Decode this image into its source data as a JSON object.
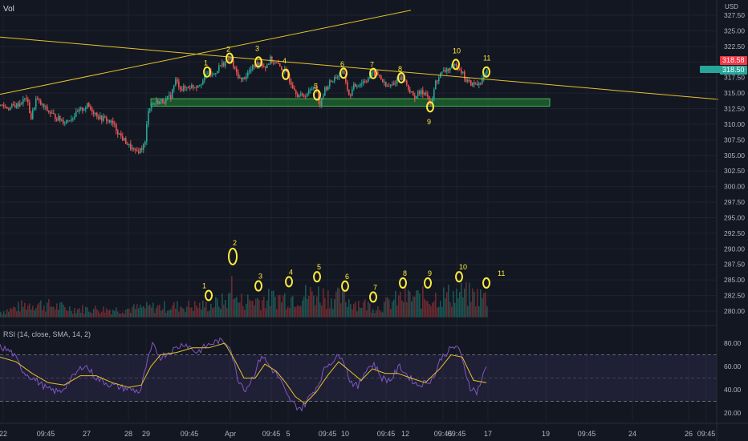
{
  "header": {
    "left_label": "Vol",
    "currency": "USD"
  },
  "indicator": {
    "label": "RSI (14, close, SMA, 14, 2)"
  },
  "price_axis": {
    "ticks": [
      "327.50",
      "325.00",
      "322.50",
      "320.00",
      "317.50",
      "315.00",
      "312.50",
      "310.00",
      "307.50",
      "305.00",
      "302.50",
      "300.00",
      "297.50",
      "295.00",
      "292.50",
      "290.00",
      "287.50",
      "285.00",
      "282.50",
      "280.00"
    ],
    "last_price": "318.58",
    "second_tag": "318.50"
  },
  "rsi_axis": {
    "ticks": [
      "80.00",
      "60.00",
      "40.00",
      "20.00"
    ],
    "upper_band": 70,
    "lower_band": 30
  },
  "time_axis": {
    "ticks": [
      "22",
      "09:45",
      "27",
      "28",
      "29",
      "09:45",
      "Apr",
      "09:45",
      "5",
      "09:45",
      "10",
      "09:45",
      "12",
      "09:45",
      "09:45",
      "17",
      "19",
      "09:45",
      "24",
      "26",
      "09:45"
    ]
  },
  "colors": {
    "background": "#131722",
    "up": "#26a69a",
    "down": "#ef5350",
    "trendline": "#e6c229",
    "annotation": "#ffeb3b",
    "rsi_line": "#7e57c2",
    "rsi_ma": "#e6c229",
    "zone_fill": "#1e6b2f",
    "zone_border": "#4caf50"
  },
  "chart_data": {
    "type": "candlestick",
    "y_range": [
      278.5,
      328.5
    ],
    "price_path": [
      [
        0,
        313.0
      ],
      [
        10,
        312.6
      ],
      [
        22,
        313.2
      ],
      [
        32,
        314.2
      ],
      [
        38,
        311.0
      ],
      [
        44,
        314.0
      ],
      [
        50,
        313.2
      ],
      [
        60,
        312.0
      ],
      [
        70,
        311.0
      ],
      [
        80,
        310.4
      ],
      [
        90,
        311.2
      ],
      [
        100,
        312.3
      ],
      [
        108,
        313.0
      ],
      [
        116,
        312.0
      ],
      [
        124,
        311.0
      ],
      [
        132,
        310.8
      ],
      [
        140,
        310.0
      ],
      [
        150,
        308.0
      ],
      [
        160,
        306.5
      ],
      [
        168,
        305.4
      ],
      [
        175,
        306.0
      ],
      [
        180,
        307.0
      ],
      [
        184,
        312.5
      ],
      [
        190,
        313.4
      ],
      [
        196,
        313.6
      ],
      [
        206,
        313.8
      ],
      [
        212,
        314.6
      ],
      [
        218,
        317.0
      ],
      [
        226,
        315.6
      ],
      [
        234,
        316.0
      ],
      [
        244,
        316.2
      ],
      [
        252,
        317.0
      ],
      [
        258,
        318.4
      ],
      [
        264,
        317.8
      ],
      [
        272,
        319.2
      ],
      [
        280,
        320.0
      ],
      [
        286,
        320.6
      ],
      [
        292,
        318.6
      ],
      [
        300,
        317.0
      ],
      [
        308,
        318.2
      ],
      [
        316,
        319.4
      ],
      [
        322,
        320.0
      ],
      [
        330,
        319.2
      ],
      [
        336,
        320.4
      ],
      [
        344,
        319.6
      ],
      [
        352,
        318.8
      ],
      [
        358,
        317.6
      ],
      [
        364,
        316.2
      ],
      [
        370,
        314.8
      ],
      [
        376,
        314.4
      ],
      [
        384,
        315.2
      ],
      [
        392,
        316.4
      ],
      [
        398,
        313.0
      ],
      [
        404,
        315.6
      ],
      [
        412,
        317.0
      ],
      [
        420,
        317.8
      ],
      [
        428,
        318.2
      ],
      [
        434,
        314.4
      ],
      [
        440,
        316.0
      ],
      [
        448,
        316.6
      ],
      [
        456,
        317.2
      ],
      [
        464,
        318.2
      ],
      [
        472,
        317.8
      ],
      [
        480,
        316.0
      ],
      [
        488,
        316.2
      ],
      [
        496,
        317.6
      ],
      [
        502,
        317.4
      ],
      [
        508,
        315.8
      ],
      [
        514,
        314.4
      ],
      [
        522,
        315.0
      ],
      [
        530,
        315.2
      ],
      [
        536,
        312.8
      ],
      [
        542,
        316.8
      ],
      [
        548,
        318.0
      ],
      [
        556,
        318.8
      ],
      [
        562,
        319.0
      ],
      [
        568,
        319.6
      ],
      [
        574,
        318.6
      ],
      [
        580,
        317.0
      ],
      [
        588,
        316.4
      ],
      [
        594,
        316.4
      ],
      [
        600,
        317.2
      ],
      [
        606,
        318.4
      ]
    ],
    "volume_path": [
      [
        0,
        280.4
      ],
      [
        40,
        282.6
      ],
      [
        90,
        281.2
      ],
      [
        150,
        281.0
      ],
      [
        180,
        281.5
      ],
      [
        220,
        281.8
      ],
      [
        260,
        282.0
      ],
      [
        285,
        283.5
      ],
      [
        289,
        290.0
      ],
      [
        293,
        283.0
      ],
      [
        320,
        283.5
      ],
      [
        360,
        284.2
      ],
      [
        395,
        285.0
      ],
      [
        430,
        283.5
      ],
      [
        470,
        281.5
      ],
      [
        500,
        284.0
      ],
      [
        535,
        284.0
      ],
      [
        572,
        285.0
      ],
      [
        606,
        284.0
      ]
    ],
    "rsi_path": [
      [
        0,
        77
      ],
      [
        15,
        72
      ],
      [
        30,
        55
      ],
      [
        45,
        48
      ],
      [
        60,
        40
      ],
      [
        75,
        38
      ],
      [
        90,
        50
      ],
      [
        105,
        62
      ],
      [
        120,
        50
      ],
      [
        135,
        45
      ],
      [
        150,
        42
      ],
      [
        165,
        40
      ],
      [
        175,
        38
      ],
      [
        182,
        60
      ],
      [
        190,
        78
      ],
      [
        200,
        68
      ],
      [
        215,
        74
      ],
      [
        230,
        80
      ],
      [
        245,
        72
      ],
      [
        258,
        78
      ],
      [
        272,
        82
      ],
      [
        286,
        79
      ],
      [
        296,
        50
      ],
      [
        306,
        40
      ],
      [
        316,
        52
      ],
      [
        326,
        70
      ],
      [
        336,
        60
      ],
      [
        348,
        50
      ],
      [
        358,
        34
      ],
      [
        368,
        26
      ],
      [
        376,
        24
      ],
      [
        386,
        34
      ],
      [
        396,
        44
      ],
      [
        406,
        60
      ],
      [
        416,
        66
      ],
      [
        426,
        70
      ],
      [
        436,
        48
      ],
      [
        446,
        42
      ],
      [
        456,
        58
      ],
      [
        466,
        62
      ],
      [
        476,
        50
      ],
      [
        486,
        48
      ],
      [
        498,
        60
      ],
      [
        508,
        52
      ],
      [
        520,
        44
      ],
      [
        530,
        46
      ],
      [
        540,
        50
      ],
      [
        550,
        68
      ],
      [
        560,
        74
      ],
      [
        570,
        78
      ],
      [
        578,
        60
      ],
      [
        586,
        42
      ],
      [
        594,
        38
      ],
      [
        600,
        48
      ],
      [
        606,
        60
      ]
    ],
    "rsi_ma_path": [
      [
        0,
        68
      ],
      [
        20,
        64
      ],
      [
        40,
        54
      ],
      [
        60,
        46
      ],
      [
        80,
        44
      ],
      [
        100,
        52
      ],
      [
        120,
        52
      ],
      [
        140,
        46
      ],
      [
        160,
        42
      ],
      [
        176,
        44
      ],
      [
        188,
        60
      ],
      [
        200,
        70
      ],
      [
        220,
        72
      ],
      [
        240,
        76
      ],
      [
        260,
        76
      ],
      [
        280,
        80
      ],
      [
        292,
        66
      ],
      [
        304,
        50
      ],
      [
        318,
        50
      ],
      [
        330,
        62
      ],
      [
        344,
        56
      ],
      [
        356,
        46
      ],
      [
        368,
        34
      ],
      [
        380,
        28
      ],
      [
        394,
        38
      ],
      [
        408,
        52
      ],
      [
        422,
        64
      ],
      [
        436,
        56
      ],
      [
        450,
        48
      ],
      [
        464,
        58
      ],
      [
        480,
        54
      ],
      [
        496,
        54
      ],
      [
        512,
        50
      ],
      [
        530,
        46
      ],
      [
        548,
        58
      ],
      [
        562,
        70
      ],
      [
        576,
        68
      ],
      [
        590,
        48
      ],
      [
        606,
        46
      ]
    ],
    "trendlines": [
      {
        "from": [
          0,
          324.0
        ],
        "to": [
          895,
          314.0
        ]
      },
      {
        "from": [
          0,
          314.8
        ],
        "to": [
          512,
          328.3
        ]
      }
    ],
    "support_zone": {
      "x_start": 188,
      "x_end": 685,
      "price_high": 314.1,
      "price_low": 312.9
    },
    "price_annotations": [
      {
        "label": "1",
        "x": 258
      },
      {
        "label": "2",
        "x": 286
      },
      {
        "label": "3",
        "x": 322
      },
      {
        "label": "4",
        "x": 356
      },
      {
        "label": "5",
        "x": 395
      },
      {
        "label": "6",
        "x": 428
      },
      {
        "label": "7",
        "x": 465
      },
      {
        "label": "8",
        "x": 500
      },
      {
        "label": "9",
        "x": 536
      },
      {
        "label": "10",
        "x": 568
      },
      {
        "label": "11",
        "x": 606
      }
    ],
    "volume_annotations": [
      {
        "label": "1",
        "x": 260
      },
      {
        "label": "2",
        "x": 290
      },
      {
        "label": "3",
        "x": 322
      },
      {
        "label": "4",
        "x": 360
      },
      {
        "label": "5",
        "x": 395
      },
      {
        "label": "6",
        "x": 430
      },
      {
        "label": "7",
        "x": 465
      },
      {
        "label": "8",
        "x": 502
      },
      {
        "label": "9",
        "x": 533
      },
      {
        "label": "10",
        "x": 572
      },
      {
        "label": "11",
        "x": 606
      }
    ]
  }
}
